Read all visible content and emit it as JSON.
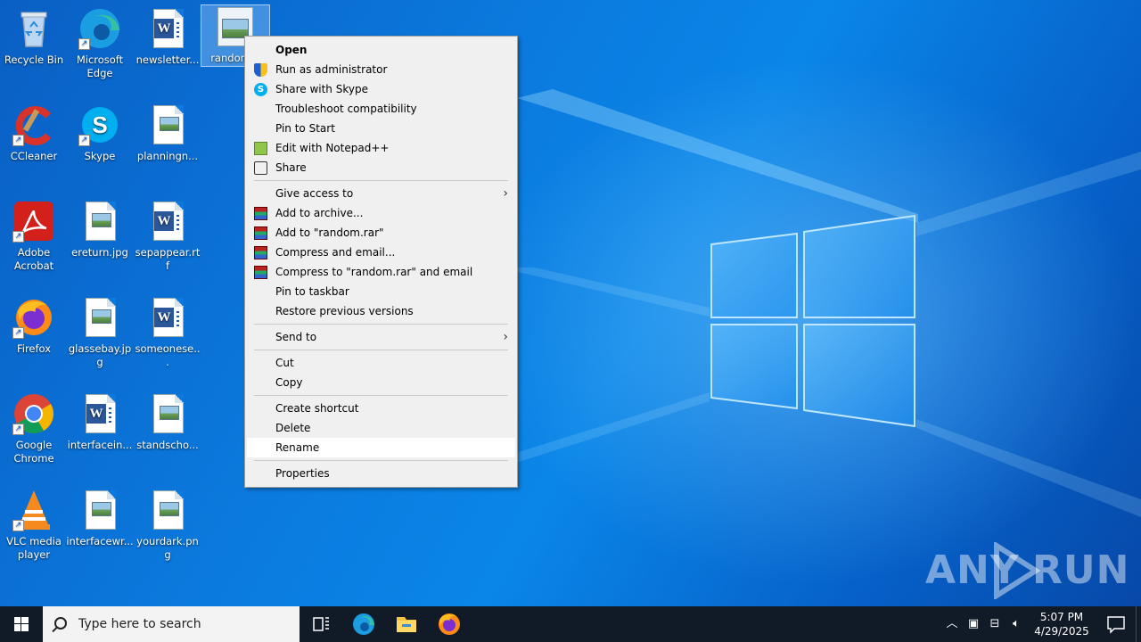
{
  "desktop": {
    "icons": [
      {
        "label": "Recycle Bin",
        "icon": "recycle-bin-icon"
      },
      {
        "label": "Microsoft Edge",
        "icon": "edge-icon"
      },
      {
        "label": "newsletter...",
        "icon": "word-document-icon"
      },
      {
        "label": "random...",
        "icon": "image-file-icon"
      },
      {
        "label": "CCleaner",
        "icon": "ccleaner-icon"
      },
      {
        "label": "Skype",
        "icon": "skype-icon"
      },
      {
        "label": "planningn...",
        "icon": "image-file-icon"
      },
      {
        "label": "Adobe Acrobat",
        "icon": "acrobat-icon"
      },
      {
        "label": "ereturn.jpg",
        "icon": "image-file-icon"
      },
      {
        "label": "sepappear.rtf",
        "icon": "word-document-icon"
      },
      {
        "label": "Firefox",
        "icon": "firefox-icon"
      },
      {
        "label": "glassebay.jpg",
        "icon": "image-file-icon"
      },
      {
        "label": "someonese...",
        "icon": "word-document-icon"
      },
      {
        "label": "Google Chrome",
        "icon": "chrome-icon"
      },
      {
        "label": "interfacein...",
        "icon": "word-document-icon"
      },
      {
        "label": "standscho...",
        "icon": "image-file-icon"
      },
      {
        "label": "VLC media player",
        "icon": "vlc-icon"
      },
      {
        "label": "interfacewr...",
        "icon": "image-file-icon"
      },
      {
        "label": "yourdark.png",
        "icon": "image-file-icon"
      }
    ]
  },
  "context_menu": {
    "items": [
      {
        "label": "Open",
        "bold": true
      },
      {
        "label": "Run as administrator",
        "icon": "shield-icon"
      },
      {
        "label": "Share with Skype",
        "icon": "skype-icon"
      },
      {
        "label": "Troubleshoot compatibility"
      },
      {
        "label": "Pin to Start"
      },
      {
        "label": "Edit with Notepad++",
        "icon": "notepadpp-icon"
      },
      {
        "label": "Share",
        "icon": "share-icon"
      },
      {
        "label": "Give access to",
        "submenu": true
      },
      {
        "label": "Add to archive...",
        "icon": "winrar-icon"
      },
      {
        "label": "Add to \"random.rar\"",
        "icon": "winrar-icon"
      },
      {
        "label": "Compress and email...",
        "icon": "winrar-icon"
      },
      {
        "label": "Compress to \"random.rar\" and email",
        "icon": "winrar-icon"
      },
      {
        "label": "Pin to taskbar"
      },
      {
        "label": "Restore previous versions"
      },
      {
        "label": "Send to",
        "submenu": true
      },
      {
        "label": "Cut"
      },
      {
        "label": "Copy"
      },
      {
        "label": "Create shortcut"
      },
      {
        "label": "Delete"
      },
      {
        "label": "Rename",
        "highlighted": true
      },
      {
        "label": "Properties"
      }
    ]
  },
  "watermark": {
    "left": "ANY",
    "right": "RUN"
  },
  "taskbar": {
    "search_placeholder": "Type here to search",
    "pinned": [
      "task-view-icon",
      "edge-icon",
      "file-explorer-icon",
      "firefox-icon"
    ],
    "clock_time": "5:07 PM",
    "clock_date": "4/29/2025"
  },
  "colors": {
    "menu_bg": "#f0f0f0",
    "taskbar_bg": "#111a27",
    "wallpaper": "#0b79dd"
  }
}
